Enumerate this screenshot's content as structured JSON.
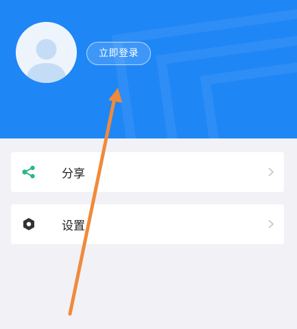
{
  "header": {
    "login_label": "立即登录",
    "bg_color": "#1f86f6"
  },
  "menu": {
    "items": [
      {
        "label": "分享",
        "icon": "share-icon",
        "icon_color": "#2bb58b"
      },
      {
        "label": "设置",
        "icon": "settings-hexagon-icon",
        "icon_color": "#333333"
      }
    ]
  },
  "annotation": {
    "arrow_color": "#f08a3a",
    "icon": "arrow-annotation"
  }
}
